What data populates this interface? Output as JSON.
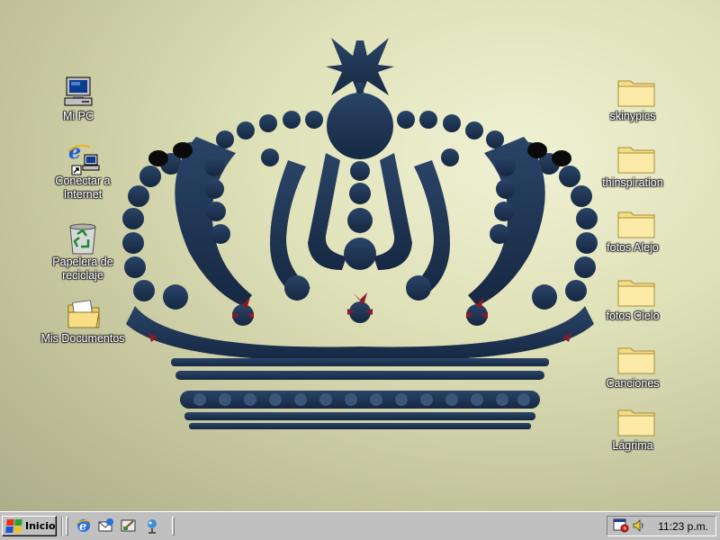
{
  "desktop": {
    "left_icons": [
      {
        "name": "mi-pc",
        "icon": "computer-icon",
        "label": "Mi PC"
      },
      {
        "name": "conectar-internet",
        "icon": "internet-explorer-icon",
        "label": "Conectar a Internet"
      },
      {
        "name": "papelera-reciclaje",
        "icon": "recycle-bin-icon",
        "label": "Papelera de reciclaje"
      },
      {
        "name": "mis-documentos",
        "icon": "documents-folder-icon",
        "label": "Mis Documentos"
      }
    ],
    "right_icons": [
      {
        "name": "skinypics",
        "icon": "folder-icon",
        "label": "skinypics"
      },
      {
        "name": "thinspiration",
        "icon": "folder-icon",
        "label": "thinspiration"
      },
      {
        "name": "fotos-alejo",
        "icon": "folder-icon",
        "label": "fotos Alejo"
      },
      {
        "name": "fotos-cielo",
        "icon": "folder-icon",
        "label": "fotos Cielo"
      },
      {
        "name": "canciones",
        "icon": "folder-icon",
        "label": "Canciones"
      },
      {
        "name": "lagrima",
        "icon": "folder-icon",
        "label": "Lágrima"
      }
    ],
    "wallpaper": {
      "subject": "crown",
      "crown_color": "#1f3452",
      "accent_color": "#8b1a24"
    }
  },
  "taskbar": {
    "start_label": "Inicio",
    "quick_launch": [
      "internet-explorer-icon",
      "outlook-express-icon",
      "show-desktop-icon",
      "channels-icon"
    ],
    "tray_icons": [
      "scheduler-icon",
      "volume-icon"
    ],
    "clock": "11:23 p.m."
  }
}
